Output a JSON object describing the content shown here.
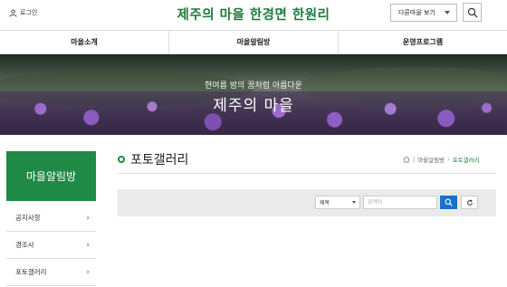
{
  "header": {
    "login_label": "로그인",
    "site_title": "제주의 마을 한경면 한원리",
    "other_village_label": "다른마을 보기"
  },
  "nav": {
    "items": [
      "마을소개",
      "마을알림방",
      "운영프로그램"
    ]
  },
  "hero": {
    "subtitle": "현여름 밤의 꿈처럼 아름다운",
    "title": "제주의 마을"
  },
  "sidebar": {
    "heading": "마을알림방",
    "items": [
      {
        "label": "공지사항"
      },
      {
        "label": "경조사"
      },
      {
        "label": "포토갤러리"
      }
    ]
  },
  "content": {
    "title": "포토갤러리",
    "breadcrumb": [
      "마을알림방",
      "포토갤러리"
    ]
  },
  "search": {
    "field_selected": "제목",
    "keyword_placeholder": "검색어"
  },
  "colors": {
    "brand_green": "#1f8a45",
    "search_blue": "#1a72c8"
  },
  "icons": {
    "login": "user-icon",
    "top_search": "search-icon",
    "home": "home-icon",
    "reset": "refresh-icon"
  }
}
